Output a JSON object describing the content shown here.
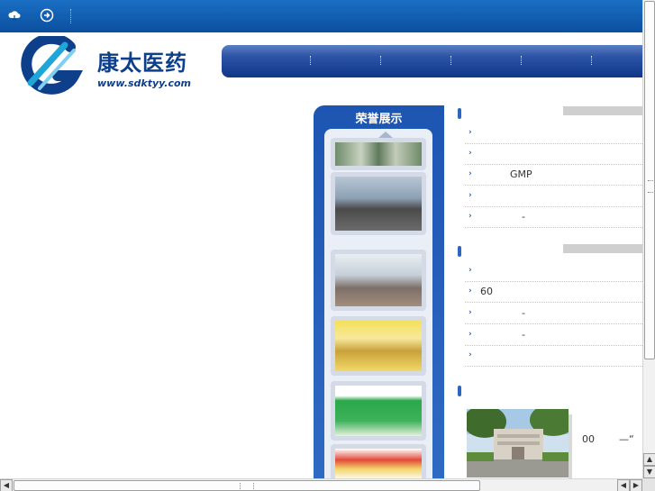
{
  "header": {
    "icons": [
      "cloud-icon",
      "arrow-circle-icon"
    ]
  },
  "logo": {
    "brand": "康太医药",
    "url": "www.sdktyy.com",
    "colors": {
      "primary": "#0d3f8a",
      "accent": "#1fa6d9"
    }
  },
  "honor": {
    "title": "荣誉展示"
  },
  "news1": {
    "items": [
      {
        "text": ""
      },
      {
        "text": ""
      },
      {
        "text": "GMP"
      },
      {
        "text": ""
      },
      {
        "text": "-"
      }
    ]
  },
  "news2": {
    "items": [
      {
        "text": ""
      },
      {
        "text": "60"
      },
      {
        "text": "-"
      },
      {
        "text": "-"
      },
      {
        "text": ""
      }
    ]
  },
  "company": {
    "text_left": "00",
    "text_right": "—“"
  },
  "colors": {
    "topbar": "#0b4f9e",
    "nav": "#0e3689",
    "panel": "#1d55b2",
    "bullet": "#1f5fb9"
  }
}
